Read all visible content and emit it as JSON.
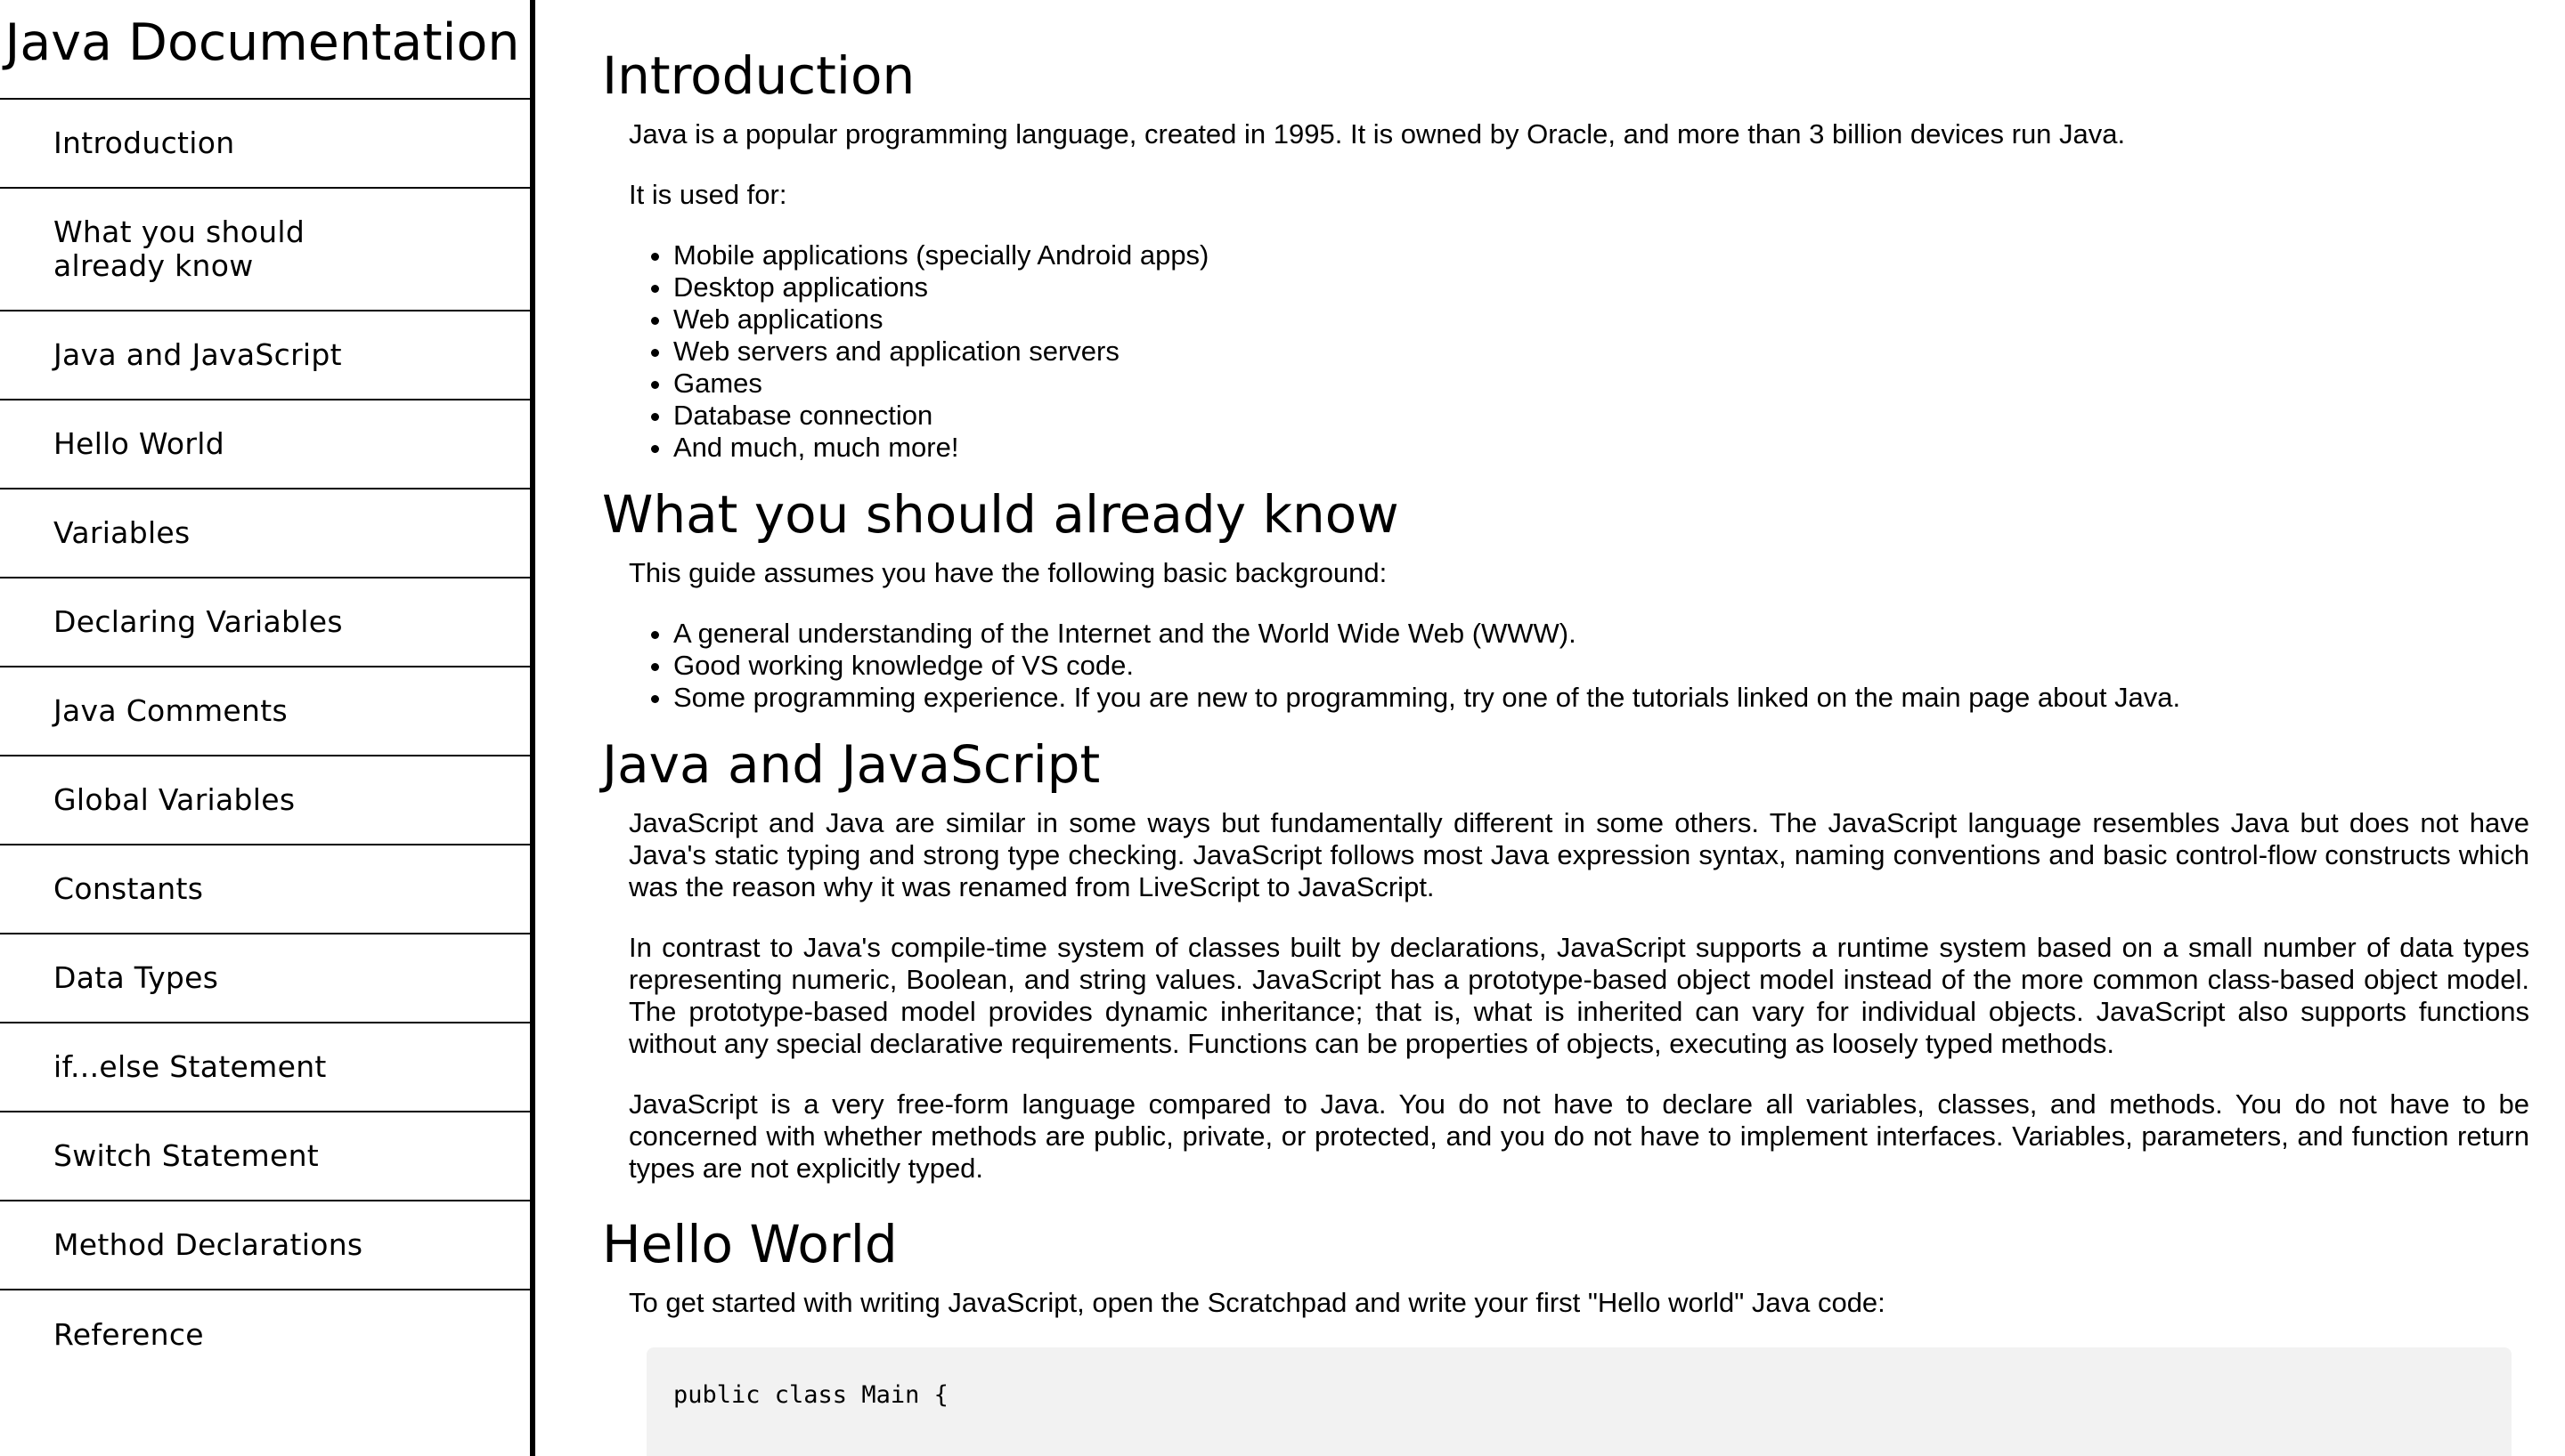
{
  "navbar": {
    "title": "Java Documentation",
    "items": [
      {
        "label": "Introduction"
      },
      {
        "label": "What you should already know"
      },
      {
        "label": "Java and JavaScript"
      },
      {
        "label": "Hello World"
      },
      {
        "label": "Variables"
      },
      {
        "label": "Declaring Variables"
      },
      {
        "label": "Java Comments"
      },
      {
        "label": "Global Variables"
      },
      {
        "label": "Constants"
      },
      {
        "label": "Data Types"
      },
      {
        "label": "if...else Statement"
      },
      {
        "label": "Switch Statement"
      },
      {
        "label": "Method Declarations"
      },
      {
        "label": "Reference"
      }
    ]
  },
  "main": {
    "intro": {
      "title": "Introduction",
      "p1": "Java is a popular programming language, created in 1995. It is owned by Oracle, and more than 3 billion devices run Java.",
      "p2": "It is used for:",
      "list": [
        "Mobile applications (specially Android apps)",
        "Desktop applications",
        "Web applications",
        "Web servers and application servers",
        "Games",
        "Database connection",
        "And much, much more!"
      ]
    },
    "know": {
      "title": "What you should already know",
      "p1": "This guide assumes you have the following basic background:",
      "list": [
        "A general understanding of the Internet and the World Wide Web (WWW).",
        "Good working knowledge of VS code.",
        "Some programming experience. If you are new to programming, try one of the tutorials linked on the main page about Java."
      ]
    },
    "javajs": {
      "title": "Java and JavaScript",
      "p1": "JavaScript and Java are similar in some ways but fundamentally different in some others. The JavaScript language resembles Java but does not have Java's static typing and strong type checking. JavaScript follows most Java expression syntax, naming conventions and basic control-flow constructs which was the reason why it was renamed from LiveScript to JavaScript.",
      "p2": "In contrast to Java's compile-time system of classes built by declarations, JavaScript supports a runtime system based on a small number of data types representing numeric, Boolean, and string values. JavaScript has a prototype-based object model instead of the more common class-based object model. The prototype-based model provides dynamic inheritance; that is, what is inherited can vary for individual objects. JavaScript also supports functions without any special declarative requirements. Functions can be properties of objects, executing as loosely typed methods.",
      "p3": "JavaScript is a very free-form language compared to Java. You do not have to declare all variables, classes, and methods. You do not have to be concerned with whether methods are public, private, or protected, and you do not have to implement interfaces. Variables, parameters, and function return types are not explicitly typed."
    },
    "hello": {
      "title": "Hello World",
      "p1": "To get started with writing JavaScript, open the Scratchpad and write your first \"Hello world\" Java code:",
      "code": "public class Main {"
    }
  }
}
